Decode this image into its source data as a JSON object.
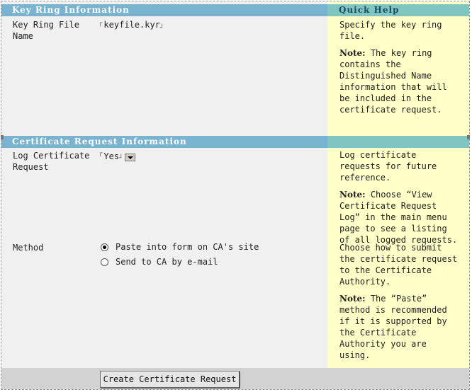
{
  "sections": {
    "key_ring": {
      "title": "Key Ring Information",
      "file_label": "Key Ring File Name",
      "file_value": "keyfile.kyr"
    },
    "cert_request": {
      "title": "Certificate Request Information",
      "log_label": "Log Certificate Request",
      "log_value": "Yes",
      "method_label": "Method",
      "method_options": [
        {
          "label": "Paste into form on CA's site",
          "selected": true
        },
        {
          "label": "Send to CA by e-mail",
          "selected": false
        }
      ]
    }
  },
  "help": {
    "title": "Quick Help",
    "key_ring_text": "Specify the key ring file.",
    "key_ring_note_label": "Note:",
    "key_ring_note": " The key ring contains the Distinguished Name information that will be included in the certificate request.",
    "log_text": "Log certificate requests for future reference.",
    "log_note_label": "Note:",
    "log_note": " Choose “View Certificate Request Log” in the main menu page to see a listing of all logged requests.",
    "method_text": "Choose how to submit the certificate request to the Certificate Authority.",
    "method_note_label": "Note:",
    "method_note": " The “Paste” method is recommended if it is supported by the Certificate Authority you are using."
  },
  "footer": {
    "submit_label": "Create Certificate Request"
  }
}
